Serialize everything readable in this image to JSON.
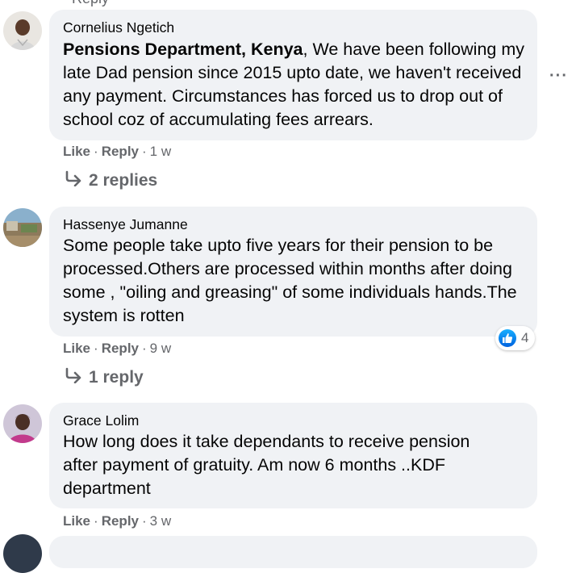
{
  "comments": [
    {
      "author": "Cornelius Ngetich",
      "mention": "Pensions Department, Kenya",
      "text": ", We have been following my late Dad pension since 2015 upto date, we haven't received any payment. Circumstances has forced us to drop out of school coz of accumulating fees arrears.",
      "like_label": "Like",
      "reply_label": "Reply",
      "time": "1 w",
      "replies_label": "2 replies"
    },
    {
      "author": "Hassenye Jumanne",
      "text": "Some people take upto five years for their pension to be processed.Others are processed within months after doing some , \"oiling and greasing\" of some individuals hands.The system is rotten",
      "like_label": "Like",
      "reply_label": "Reply",
      "time": "9 w",
      "reaction_count": "4",
      "replies_label": "1 reply"
    },
    {
      "author": "Grace Lolim",
      "text": "How long does it take dependants to receive pension after payment of gratuity. Am now 6 months ..KDF department",
      "like_label": "Like",
      "reply_label": "Reply",
      "time": "3 w"
    }
  ],
  "separator": "·",
  "more_options": "···",
  "icons": {
    "reply_arrow": "reply-arrow-icon",
    "like_reaction": "like-reaction-icon",
    "more": "more-options-icon"
  },
  "colors": {
    "bubble": "#f0f2f5",
    "secondary_text": "#65676b",
    "primary_text": "#050505",
    "like_blue": "#1877f2"
  }
}
